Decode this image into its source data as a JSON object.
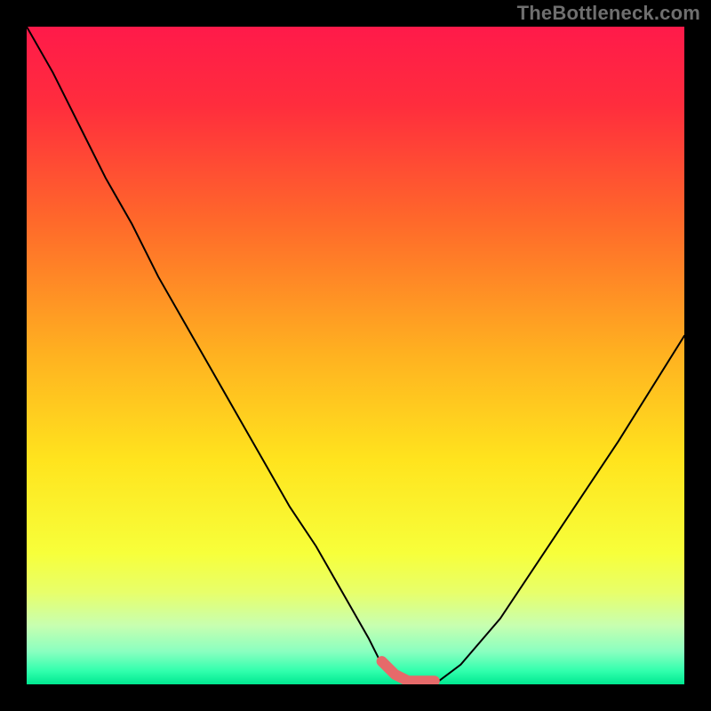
{
  "watermark": "TheBottleneck.com",
  "colors": {
    "border": "#000000",
    "curve": "#000000",
    "marker": "#e66a6a"
  },
  "chart_data": {
    "type": "line",
    "title": "",
    "xlabel": "",
    "ylabel": "",
    "xlim": [
      0,
      100
    ],
    "ylim": [
      0,
      100
    ],
    "series": [
      {
        "name": "bottleneck-curve",
        "x": [
          0,
          4,
          8,
          12,
          16,
          20,
          24,
          28,
          32,
          36,
          40,
          44,
          48,
          52,
          54,
          56,
          58,
          60,
          62,
          66,
          72,
          80,
          90,
          100
        ],
        "y": [
          100,
          93,
          85,
          77,
          70,
          62,
          55,
          48,
          41,
          34,
          27,
          21,
          14,
          7,
          3,
          1,
          0,
          0,
          0,
          3,
          10,
          22,
          37,
          53
        ]
      }
    ],
    "marker": {
      "name": "optimal-range",
      "x_start": 54,
      "x_end": 62,
      "y": 0
    },
    "gradient_stops": [
      {
        "offset": 0.0,
        "color": "#ff1a4a"
      },
      {
        "offset": 0.12,
        "color": "#ff2d3d"
      },
      {
        "offset": 0.3,
        "color": "#ff6a2a"
      },
      {
        "offset": 0.5,
        "color": "#ffb220"
      },
      {
        "offset": 0.66,
        "color": "#ffe41e"
      },
      {
        "offset": 0.8,
        "color": "#f7ff3a"
      },
      {
        "offset": 0.86,
        "color": "#e8ff6a"
      },
      {
        "offset": 0.91,
        "color": "#c8ffb0"
      },
      {
        "offset": 0.95,
        "color": "#8affc0"
      },
      {
        "offset": 0.98,
        "color": "#30ffad"
      },
      {
        "offset": 1.0,
        "color": "#00e890"
      }
    ]
  }
}
